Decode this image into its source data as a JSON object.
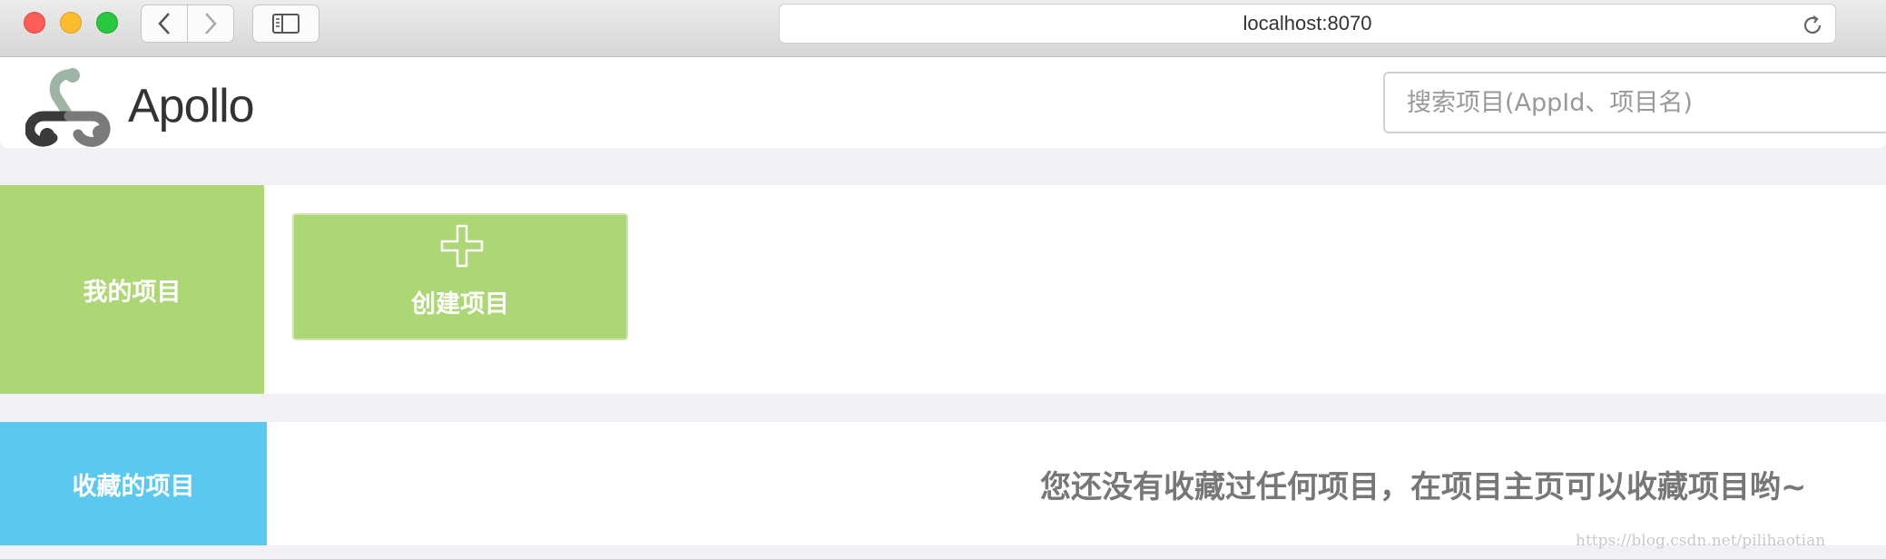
{
  "browser": {
    "url": "localhost:8070",
    "icons": {
      "back": "chevron-left-icon",
      "forward": "chevron-right-icon",
      "sidebar": "sidebar-icon",
      "reload": "reload-icon"
    }
  },
  "header": {
    "logo_text": "Apollo",
    "search_placeholder": "搜索项目(AppId、项目名)"
  },
  "my_projects": {
    "label": "我的项目",
    "create_label": "创建项目",
    "color": "#acd774"
  },
  "favorites": {
    "label": "收藏的项目",
    "empty_message": "您还没有收藏过任何项目，在项目主页可以收藏项目哟~",
    "color": "#5bc8f0"
  },
  "watermark": "https://blog.csdn.net/pilihaotian"
}
